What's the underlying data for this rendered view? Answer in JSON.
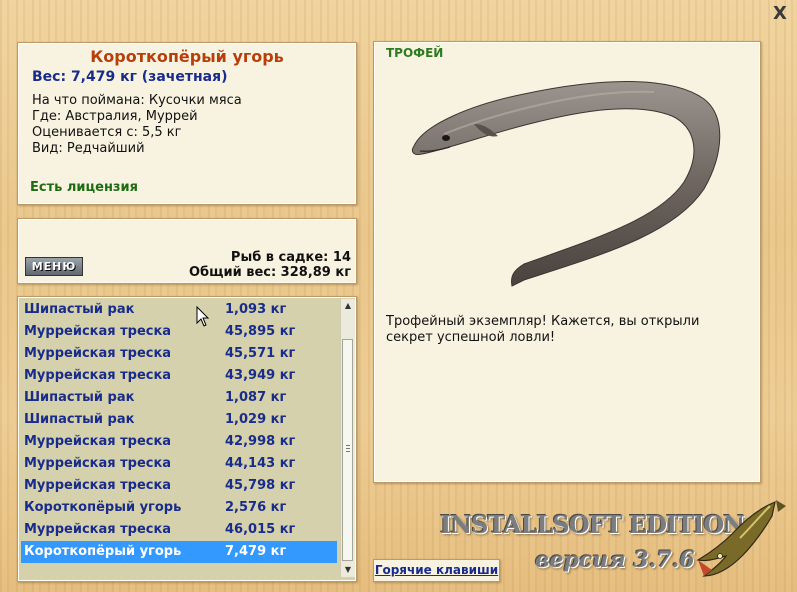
{
  "window": {
    "close_glyph": "X"
  },
  "fish": {
    "title": "Короткопёрый угорь",
    "weight": "Вес: 7,479 кг (зачетная)",
    "bait": "На что поймана: Кусочки мяса",
    "location": "Где: Австралия, Муррей",
    "rated_from": "Оценивается с: 5,5 кг",
    "rarity": "Вид: Редчайший",
    "license": "Есть лицензия"
  },
  "keepnet": {
    "menu_label": "МЕНЮ",
    "fish_count": "Рыб в садке: 14",
    "total_weight": "Общий вес: 328,89 кг"
  },
  "catch_list": [
    {
      "name": "Шипастый рак",
      "weight": "1,093 кг"
    },
    {
      "name": "Муррейская треска",
      "weight": "45,895 кг"
    },
    {
      "name": "Муррейская треска",
      "weight": "45,571 кг"
    },
    {
      "name": "Муррейская треска",
      "weight": "43,949 кг"
    },
    {
      "name": "Шипастый рак",
      "weight": "1,087 кг"
    },
    {
      "name": "Шипастый рак",
      "weight": "1,029 кг"
    },
    {
      "name": "Муррейская треска",
      "weight": "42,998 кг"
    },
    {
      "name": "Муррейская треска",
      "weight": "44,143 кг"
    },
    {
      "name": "Муррейская треска",
      "weight": "45,798 кг"
    },
    {
      "name": "Короткопёрый угорь",
      "weight": "2,576 кг"
    },
    {
      "name": "Муррейская треска",
      "weight": "46,015 кг"
    },
    {
      "name": "Короткопёрый угорь",
      "weight": "7,479 кг"
    }
  ],
  "selected_index": 11,
  "trophy": {
    "label": "ТРОФЕЙ",
    "text": "Трофейный экземпляр! Кажется, вы открыли секрет успешной ловли!"
  },
  "hotkeys_label": "Горячие клавиши",
  "brand": {
    "edition": "INSTALLSOFT EDITION",
    "version": "версия 3.7.6"
  },
  "icons": [
    "close-icon",
    "eel-image",
    "pike-logo-icon",
    "mouse-cursor-icon",
    "scroll-up-icon",
    "scroll-down-icon"
  ],
  "colors": {
    "accent_title": "#b5400c",
    "text_blue": "#1a2c8a",
    "license_green": "#1f6b12",
    "selection": "#3399ff"
  }
}
